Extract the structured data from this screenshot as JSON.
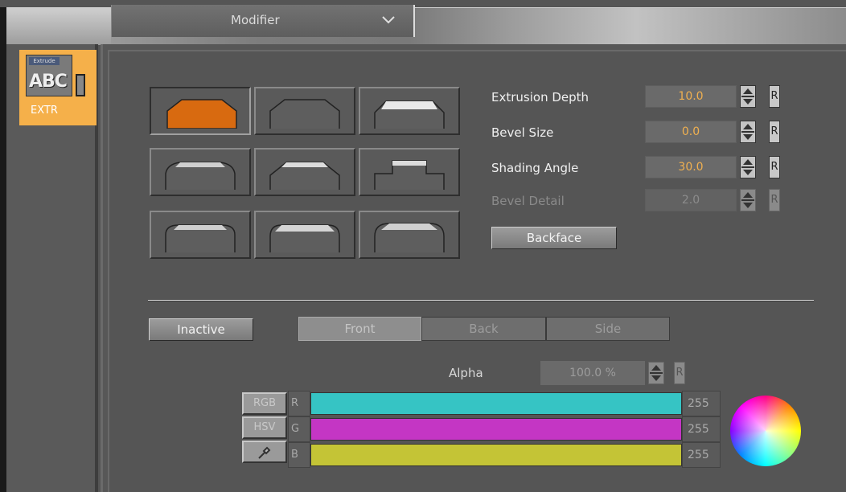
{
  "topbar": {
    "dropdown_label": "Modifier"
  },
  "sidebar": {
    "tile_label": "EXTR",
    "tile_icon_tag": "Extrude",
    "tile_icon_text": "ABC"
  },
  "params": {
    "extrusion_depth": {
      "label": "Extrusion Depth",
      "value": "10.0"
    },
    "bevel_size": {
      "label": "Bevel Size",
      "value": "0.0"
    },
    "shading_angle": {
      "label": "Shading Angle",
      "value": "30.0"
    },
    "bevel_detail": {
      "label": "Bevel Detail",
      "value": "2.0"
    },
    "reset_label": "R",
    "backface_button": "Backface"
  },
  "material": {
    "inactive_button": "Inactive",
    "tabs": [
      {
        "label": "Front",
        "active": true
      },
      {
        "label": "Back",
        "active": false
      },
      {
        "label": "Side",
        "active": false
      }
    ],
    "alpha_label": "Alpha",
    "alpha_value": "100.0 %",
    "mode_buttons": [
      "RGB",
      "HSV"
    ],
    "channels": [
      {
        "letter": "R",
        "value": "255",
        "color": "#36c4c4"
      },
      {
        "letter": "G",
        "value": "255",
        "color": "#c436c4"
      },
      {
        "letter": "B",
        "value": "255",
        "color": "#c4c436"
      }
    ]
  },
  "colors": {
    "accent": "#f5b04a",
    "selected_shape": "#d86a10",
    "value_orange": "#f0b050"
  }
}
